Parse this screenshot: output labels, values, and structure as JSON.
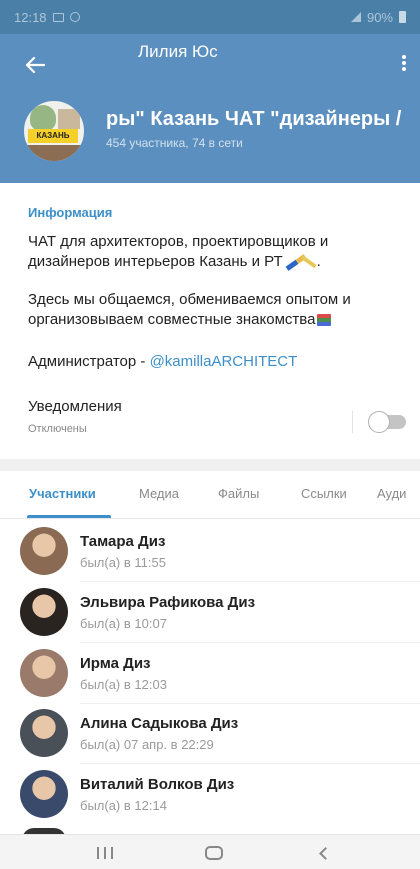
{
  "status_bar": {
    "time": "12:18",
    "battery": "90%"
  },
  "header": {
    "title": "Лилия Юс",
    "group_name": "ры\" Казань   ЧАТ \"дизайнеры / ",
    "subtitle": "454 участника, 74 в сети",
    "avatar_label": "КАЗАНЬ"
  },
  "info": {
    "heading": "Информация",
    "description_1": "ЧАТ для архитекторов, проектировщиков и дизайнеров интерьеров Казань и РТ",
    "description_2": " Здесь мы общаемся, обмениваемся опытом и организовываем совместные знакомства",
    "admin_prefix": "Администратор - ",
    "admin_handle": "@kamillaARCHITECT",
    "notifications_label": "Уведомления",
    "notifications_status": "Отключены"
  },
  "tabs": [
    {
      "label": "Участники"
    },
    {
      "label": "Медиа"
    },
    {
      "label": "Файлы"
    },
    {
      "label": "Ссылки"
    },
    {
      "label": "Ауди"
    }
  ],
  "members": [
    {
      "name": "Тамара Диз",
      "status": "был(а) в 11:55",
      "avatar_color": "#8a6a52"
    },
    {
      "name": "Эльвира Рафикова Диз",
      "status": "был(а) в 10:07",
      "avatar_color": "#2a2420"
    },
    {
      "name": "Ирма Диз",
      "status": "был(а) в 12:03",
      "avatar_color": "#9a7a6a"
    },
    {
      "name": "Алина Садыкова Диз",
      "status": "был(а) 07 апр. в 22:29",
      "avatar_color": "#4a5058"
    },
    {
      "name": "Виталий Волков Диз",
      "status": "был(а) в 12:14",
      "avatar_color": "#3a4a6a"
    }
  ],
  "colors": {
    "header_bg": "#5b8fbf",
    "accent": "#3d8fc9"
  }
}
